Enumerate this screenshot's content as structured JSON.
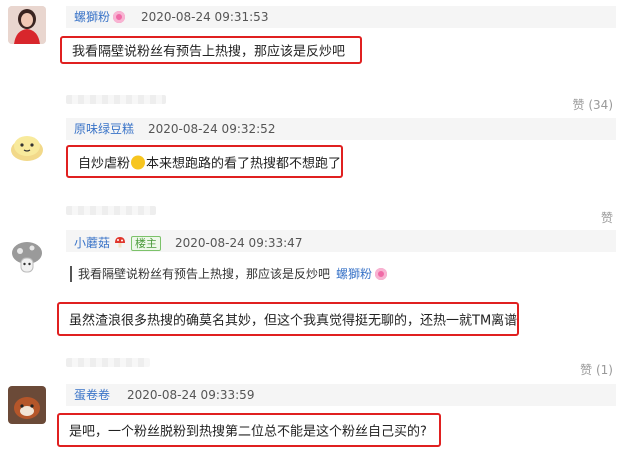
{
  "comments": [
    {
      "username": "螺獅粉",
      "time": "2020-08-24 09:31:53",
      "text": "我看隔壁说粉丝有预告上热搜，那应该是反炒吧",
      "avatar": "avatar-woman-red-dress"
    },
    {
      "likes": "赞 (34)",
      "username": "原味绿豆糕",
      "time": "2020-08-24 09:32:52",
      "text_before": "自炒虐粉",
      "text_after": "本来想跑路的看了热搜都不想跑了",
      "avatar": "avatar-cartoon-bun"
    },
    {
      "likes": "赞",
      "username": "小蘑菇",
      "owner_badge": "楼主",
      "time": "2020-08-24 09:33:47",
      "quote_text": "我看隔壁说粉丝有预告上热搜，那应该是反炒吧",
      "quote_user": "螺獅粉",
      "text": "虽然渣浪很多热搜的确莫名其妙，但这个我真觉得挺无聊的，还热一就TM离谱",
      "avatar": "avatar-mushroom"
    },
    {
      "likes": "赞 (1)",
      "username": "蛋卷卷",
      "time": "2020-08-24 09:33:59",
      "text": "是吧，一个粉丝脱粉到热搜第二位总不能是这个粉丝自己买的?",
      "avatar": "avatar-red-panda"
    }
  ],
  "colors": {
    "highlight_border": "#e02020",
    "username": "#3a74c8",
    "meta_bg": "#f5f5f5"
  }
}
